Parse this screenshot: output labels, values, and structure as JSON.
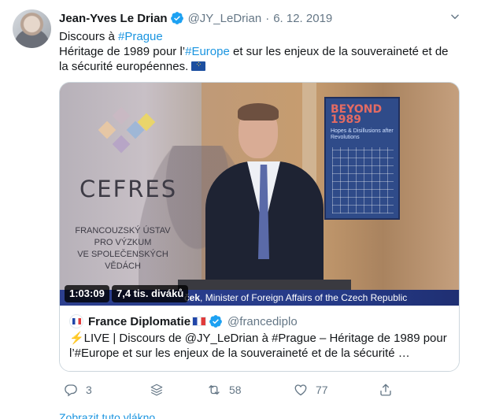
{
  "tweet": {
    "author_name": "Jean-Yves Le Drian",
    "handle": "@JY_LeDrian",
    "separator": "·",
    "date": "6. 12. 2019",
    "line1_prefix": "Discours à ",
    "line1_hashtag": "#Prague",
    "line2_prefix": "Héritage de 1989 pour l’",
    "line2_hashtag": "#Europe",
    "line2_suffix": " et sur les enjeux de la souveraineté et de la sécurité européennes.",
    "emoji_flag": "eu-flag"
  },
  "video": {
    "duration": "1:03:09",
    "views": "7,4 tis. diváků",
    "lower_third_name": "ček",
    "lower_third_role": ", Minister of Foreign Affairs of the Czech Republic",
    "backdrop_logo": "CEFRES",
    "backdrop_sub1": "FRANCOUZSKÝ ÚSTAV",
    "backdrop_sub2": "PRO VÝZKUM",
    "backdrop_sub3": "VE SPOLEČENSKÝCH VĚDÁCH",
    "poster_title": "BEYOND 1989",
    "poster_sub": "Hopes & Disillusions after Revolutions"
  },
  "card": {
    "source_name": "France Diplomatie",
    "source_handle": "@francediplo",
    "text": "⚡️LIVE | Discours de @JY_LeDrian à #Prague – Héritage de 1989 pour l’#Europe et sur les enjeux de la souveraineté et de la sécurité …"
  },
  "actions": {
    "replies": "3",
    "retweets": "58",
    "likes": "77"
  },
  "footer": {
    "link_text": "Zobrazit tuto vlákno"
  },
  "colors": {
    "link": "#1b95e0",
    "muted": "#657786",
    "verified": "#1da1f2",
    "lower_third": "#2c3f8f"
  }
}
